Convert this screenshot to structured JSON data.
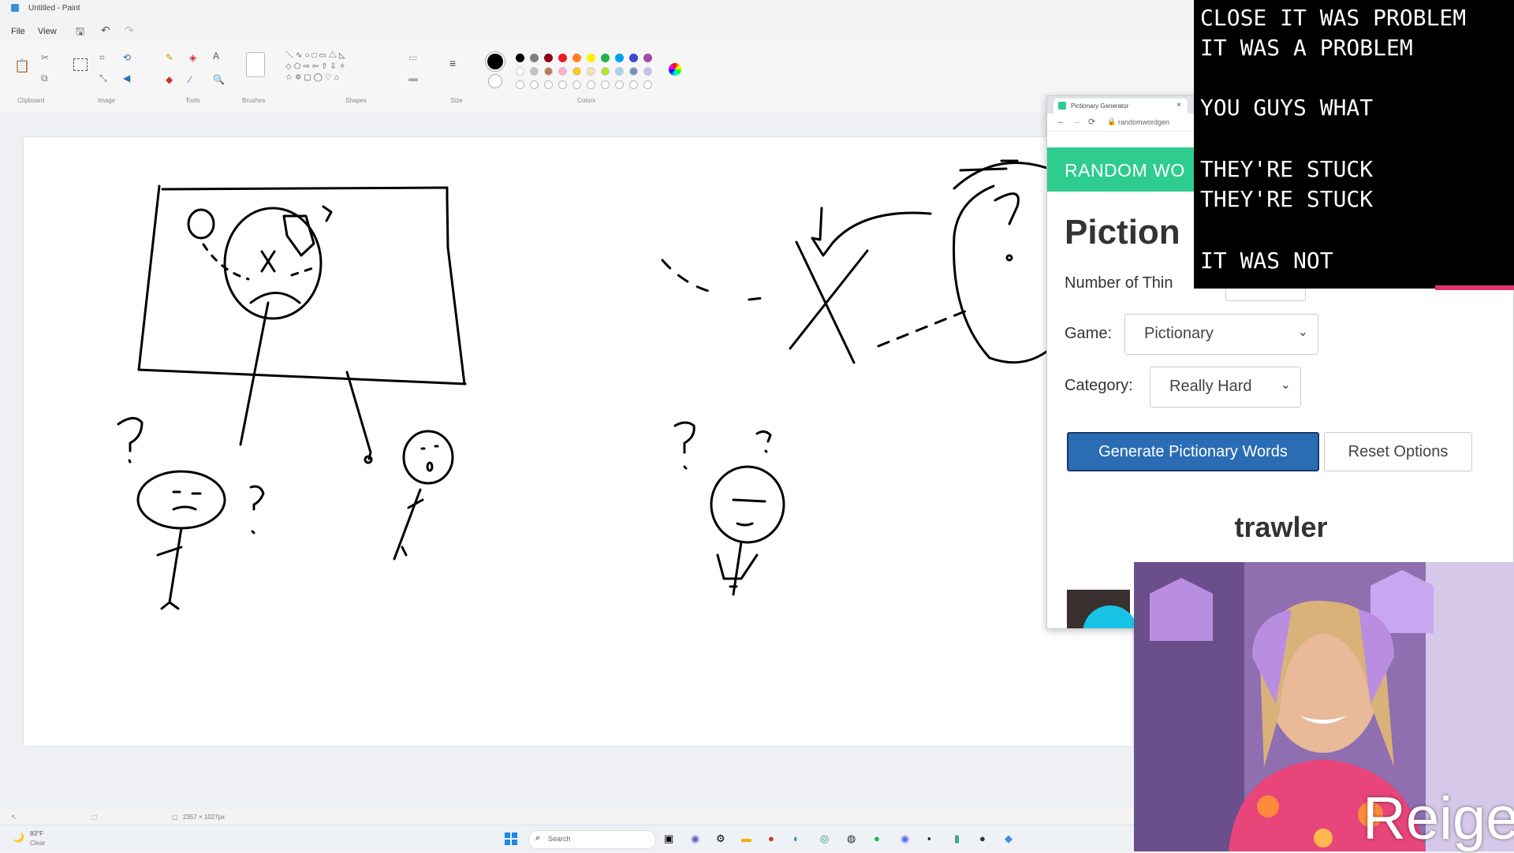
{
  "window": {
    "title": "Untitled - Paint"
  },
  "menu": {
    "file": "File",
    "view": "View"
  },
  "ribbon": {
    "groups": [
      "Clipboard",
      "Image",
      "Tools",
      "Brushes",
      "Shapes",
      "Size",
      "Colors"
    ],
    "colors": [
      "#000000",
      "#7f7f7f",
      "#880015",
      "#ed1c24",
      "#ff7f27",
      "#fff200",
      "#22b14c",
      "#00a2e8",
      "#3f48cc",
      "#a349a4"
    ],
    "colors_row2": [
      "#ffffff",
      "#c3c3c3",
      "#b97a57",
      "#ffaec9",
      "#ffc90e",
      "#efe4b0",
      "#b5e61d",
      "#99d9ea",
      "#7092be",
      "#c8bfe7"
    ]
  },
  "status": {
    "canvas_size": "2357 × 1027px"
  },
  "taskbar": {
    "weather_temp": "83°F",
    "weather_desc": "Clear",
    "search_label": "Search"
  },
  "browser": {
    "tab_title": "Pictionary Generator",
    "url": "randomwordgen",
    "banner": "RANDOM WO",
    "heading": "Piction",
    "number_label": "Number of Thin",
    "game_label": "Game:",
    "game_value": "Pictionary",
    "category_label": "Category:",
    "category_value": "Really Hard",
    "generate_button": "Generate Pictionary Words",
    "reset_button": "Reset Options",
    "generated_word": "trawler"
  },
  "chat": {
    "lines": [
      "CLOSE IT WAS PROBLEM",
      "IT WAS A PROBLEM",
      "",
      "YOU GUYS WHAT",
      "",
      "THEY'RE STUCK",
      "THEY'RE STUCK",
      "",
      "IT WAS NOT"
    ]
  },
  "webcam": {
    "streamer_name": "Reige"
  },
  "accent_colors": {
    "banner": "#2ecc8f",
    "primary_button": "#2a6db5"
  }
}
